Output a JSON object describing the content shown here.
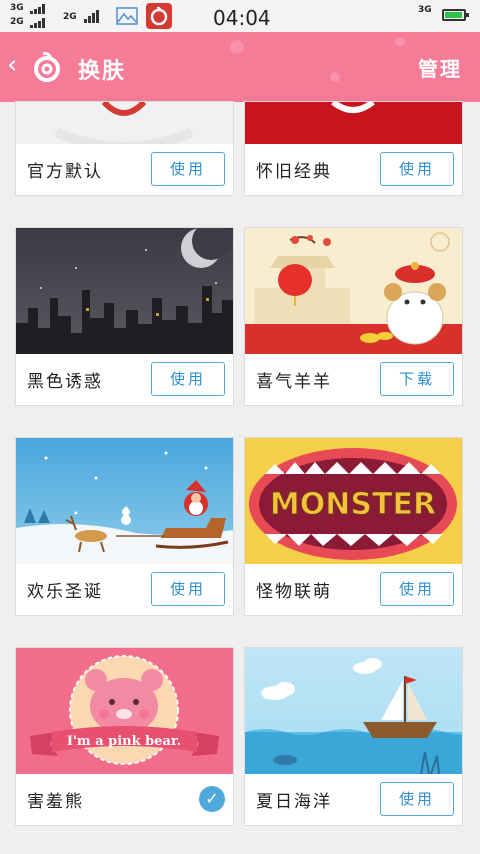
{
  "status_bar": {
    "sim1_label": "3G",
    "sim2_label": "2G",
    "network_label": "2G",
    "time": "04:04",
    "right_label": "3G"
  },
  "header": {
    "back_glyph": "‹",
    "title": "换肤",
    "manage_label": "管理"
  },
  "skins": [
    {
      "name": "官方默认",
      "action": "使用",
      "state": "use"
    },
    {
      "name": "怀旧经典",
      "action": "使用",
      "state": "use"
    },
    {
      "name": "黑色诱惑",
      "action": "使用",
      "state": "use"
    },
    {
      "name": "喜气羊羊",
      "action": "下载",
      "state": "download"
    },
    {
      "name": "欢乐圣诞",
      "action": "使用",
      "state": "use"
    },
    {
      "name": "怪物联萌",
      "action": "使用",
      "state": "use"
    },
    {
      "name": "害羞熊",
      "action": "",
      "state": "selected"
    },
    {
      "name": "夏日海洋",
      "action": "使用",
      "state": "use"
    }
  ],
  "thumb_texts": {
    "monster": "MONSTER",
    "pink_bear": "I'm a pink bear."
  },
  "colors": {
    "header": "#f57b96",
    "button_border": "#4fa9dc",
    "button_text": "#2f8fd0",
    "battery": "#2ec24a"
  },
  "icons": [
    "back-chevron-icon",
    "netease-logo-icon",
    "check-icon",
    "battery-icon",
    "signal-icon"
  ]
}
